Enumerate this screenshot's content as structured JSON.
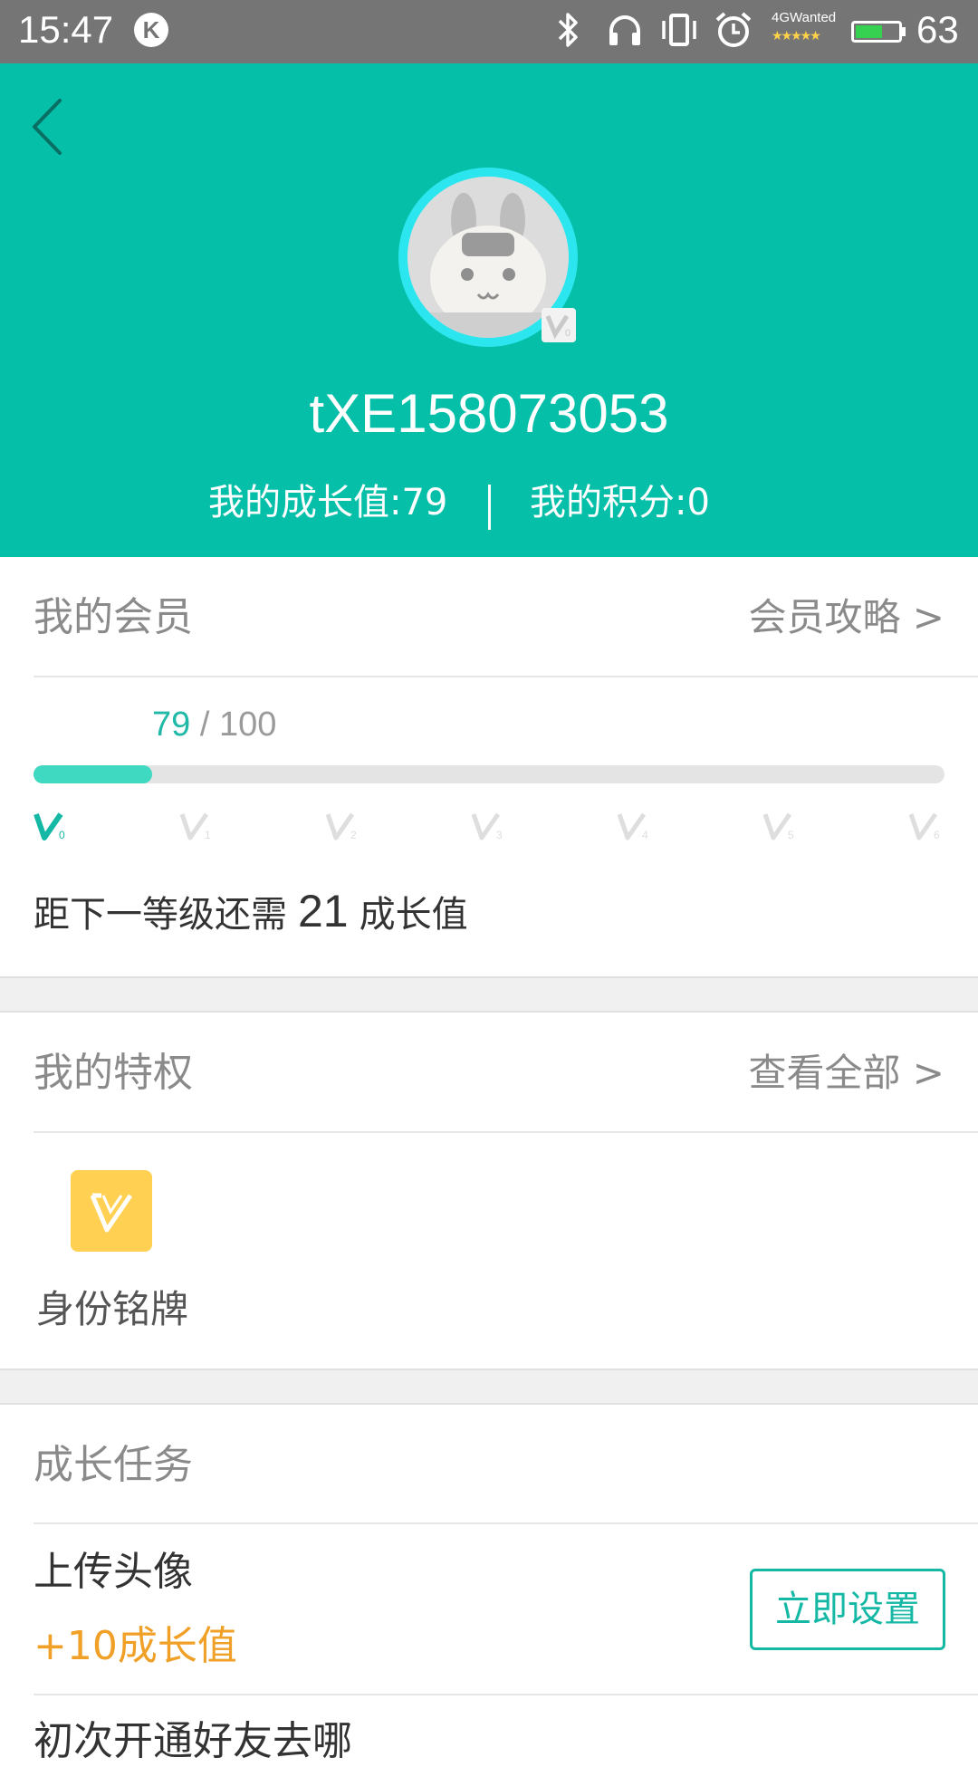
{
  "status_bar": {
    "time": "15:47",
    "k_badge": "K",
    "network_label": "4GWanted",
    "network_stars": "★★★★★",
    "battery_percent": 63,
    "battery_text": "63",
    "icons": [
      "bluetooth-icon",
      "headphones-icon",
      "vibrate-icon",
      "alarm-icon"
    ]
  },
  "profile": {
    "username": "tXE158073053",
    "growth_label": "我的成长值:79",
    "points_label": "我的积分:0",
    "badge_level": "V0"
  },
  "membership": {
    "title": "我的会员",
    "link": "会员攻略 >",
    "current": "79",
    "separator": " / ",
    "target": "100",
    "progress_fraction": 0.13,
    "levels": [
      "V0",
      "V1",
      "V2",
      "V3",
      "V4",
      "V5",
      "V6"
    ],
    "active_level_index": 0,
    "next_prefix": "距下一等级还需",
    "next_value": "21",
    "next_suffix": "成长值"
  },
  "privileges": {
    "title": "我的特权",
    "link": "查看全部 >",
    "items": [
      {
        "label": "身份铭牌",
        "icon": "v-nameplate-icon"
      }
    ]
  },
  "tasks": {
    "title": "成长任务",
    "items": [
      {
        "title": "上传头像",
        "reward": "+10成长值",
        "button": "立即设置"
      },
      {
        "title": "初次开通好友去哪"
      }
    ]
  },
  "colors": {
    "header": "#05bfa9",
    "progress": "#3fd9c2",
    "accent_text": "#20b8a6",
    "reward": "#f0a027",
    "privilege_icon_bg": "#ffd052"
  }
}
